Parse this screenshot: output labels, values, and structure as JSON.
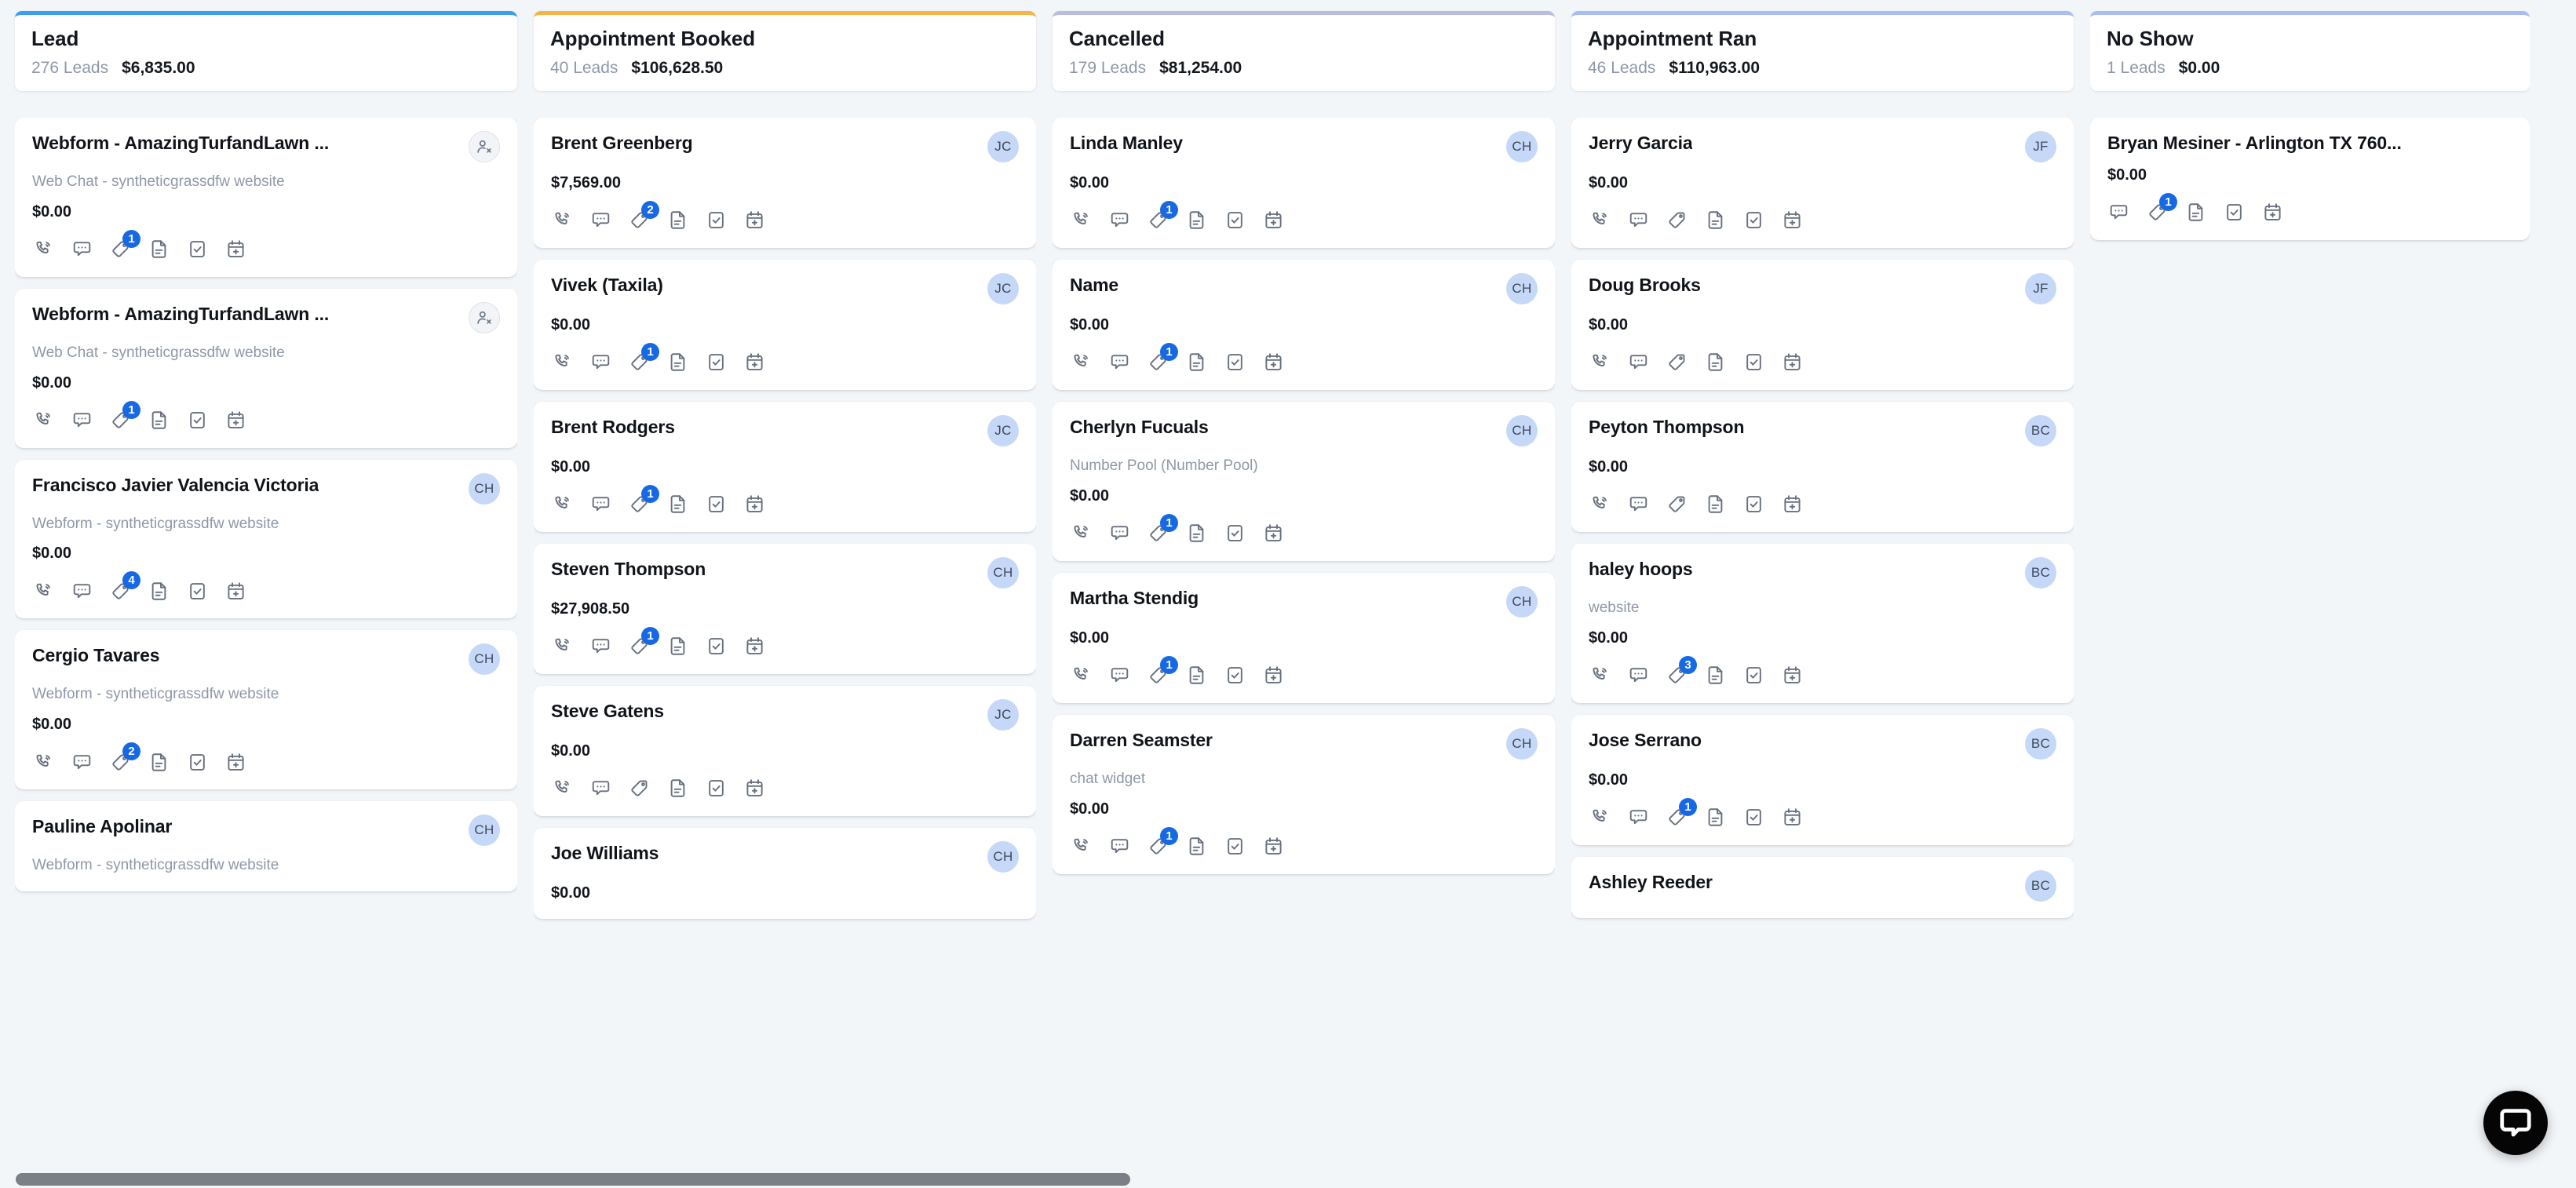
{
  "board": {
    "scrollbar": {
      "name": "horizontal-scrollbar"
    },
    "chat_widget": {
      "label": "chat-widget",
      "icon": "chat-bubble-icon"
    }
  },
  "icon_names": {
    "phone": "phone-call-icon",
    "chat": "chat-bubble-icon",
    "tag": "tag-icon",
    "doc": "document-icon",
    "task": "task-checkbox-icon",
    "calendar": "calendar-add-icon",
    "unassigned": "user-remove-icon"
  },
  "colors": {
    "accent_blue": "#3b9cf0",
    "accent_orange": "#f7b548",
    "accent_lavender": "#b9bce0",
    "accent_periwinkle": "#a9bdf2",
    "badge_blue": "#1668e3",
    "avatar_bg": "#c5d8f7",
    "board_bg": "#f3f6f9"
  },
  "columns": [
    {
      "title": "Lead",
      "leads": "276 Leads",
      "amount": "$6,835.00",
      "top_color": "#3b9cf0",
      "cards": [
        {
          "name": "Webform - AmazingTurfandLawn ...",
          "subtitle": "Web Chat - syntheticgrassdfw website",
          "amount": "$0.00",
          "avatar": "",
          "avatar_icon": "user-remove-icon",
          "icons": [
            "phone",
            "chat",
            "tag",
            "doc",
            "task",
            "calendar"
          ],
          "badge": "1"
        },
        {
          "name": "Webform - AmazingTurfandLawn ...",
          "subtitle": "Web Chat - syntheticgrassdfw website",
          "amount": "$0.00",
          "avatar": "",
          "avatar_icon": "user-remove-icon",
          "icons": [
            "phone",
            "chat",
            "tag",
            "doc",
            "task",
            "calendar"
          ],
          "badge": "1"
        },
        {
          "name": "Francisco Javier Valencia Victoria",
          "subtitle": "Webform - syntheticgrassdfw website",
          "amount": "$0.00",
          "avatar": "CH",
          "icons": [
            "phone",
            "chat",
            "tag",
            "doc",
            "task",
            "calendar"
          ],
          "badge": "4"
        },
        {
          "name": "Cergio Tavares",
          "subtitle": "Webform - syntheticgrassdfw website",
          "amount": "$0.00",
          "avatar": "CH",
          "icons": [
            "phone",
            "chat",
            "tag",
            "doc",
            "task",
            "calendar"
          ],
          "badge": "2"
        },
        {
          "name": "Pauline Apolinar",
          "subtitle": "Webform - syntheticgrassdfw website",
          "amount": "",
          "avatar": "CH",
          "icons": [],
          "badge": ""
        }
      ]
    },
    {
      "title": "Appointment Booked",
      "leads": "40 Leads",
      "amount": "$106,628.50",
      "top_color": "#f7b548",
      "cards": [
        {
          "name": "Brent Greenberg",
          "subtitle": "",
          "amount": "$7,569.00",
          "avatar": "JC",
          "icons": [
            "phone",
            "chat",
            "tag",
            "doc",
            "task",
            "calendar"
          ],
          "badge": "2"
        },
        {
          "name": "Vivek (Taxila)",
          "subtitle": "",
          "amount": "$0.00",
          "avatar": "JC",
          "icons": [
            "phone",
            "chat",
            "tag",
            "doc",
            "task",
            "calendar"
          ],
          "badge": "1"
        },
        {
          "name": "Brent Rodgers",
          "subtitle": "",
          "amount": "$0.00",
          "avatar": "JC",
          "icons": [
            "phone",
            "chat",
            "tag",
            "doc",
            "task",
            "calendar"
          ],
          "badge": "1"
        },
        {
          "name": "Steven Thompson",
          "subtitle": "",
          "amount": "$27,908.50",
          "avatar": "CH",
          "icons": [
            "phone",
            "chat",
            "tag",
            "doc",
            "task",
            "calendar"
          ],
          "badge": "1"
        },
        {
          "name": "Steve Gatens",
          "subtitle": "",
          "amount": "$0.00",
          "avatar": "JC",
          "icons": [
            "phone",
            "chat",
            "tag",
            "doc",
            "task",
            "calendar"
          ],
          "badge": ""
        },
        {
          "name": "Joe Williams",
          "subtitle": "",
          "amount": "$0.00",
          "avatar": "CH",
          "icons": [],
          "badge": ""
        }
      ]
    },
    {
      "title": "Cancelled",
      "leads": "179 Leads",
      "amount": "$81,254.00",
      "top_color": "#b9bce0",
      "cards": [
        {
          "name": "Linda Manley",
          "subtitle": "",
          "amount": "$0.00",
          "avatar": "CH",
          "icons": [
            "phone",
            "chat",
            "tag",
            "doc",
            "task",
            "calendar"
          ],
          "badge": "1"
        },
        {
          "name": "Name",
          "subtitle": "",
          "amount": "$0.00",
          "avatar": "CH",
          "icons": [
            "phone",
            "chat",
            "tag",
            "doc",
            "task",
            "calendar"
          ],
          "badge": "1"
        },
        {
          "name": "Cherlyn Fucuals",
          "subtitle": "Number Pool (Number Pool)",
          "amount": "$0.00",
          "avatar": "CH",
          "icons": [
            "phone",
            "chat",
            "tag",
            "doc",
            "task",
            "calendar"
          ],
          "badge": "1"
        },
        {
          "name": "Martha Stendig",
          "subtitle": "",
          "amount": "$0.00",
          "avatar": "CH",
          "icons": [
            "phone",
            "chat",
            "tag",
            "doc",
            "task",
            "calendar"
          ],
          "badge": "1"
        },
        {
          "name": "Darren Seamster",
          "subtitle": "chat widget",
          "amount": "$0.00",
          "avatar": "CH",
          "icons": [
            "phone",
            "chat",
            "tag",
            "doc",
            "task",
            "calendar"
          ],
          "badge": "1"
        }
      ]
    },
    {
      "title": "Appointment Ran",
      "leads": "46 Leads",
      "amount": "$110,963.00",
      "top_color": "#a9bdf2",
      "cards": [
        {
          "name": "Jerry Garcia",
          "subtitle": "",
          "amount": "$0.00",
          "avatar": "JF",
          "icons": [
            "phone",
            "chat",
            "tag",
            "doc",
            "task",
            "calendar"
          ],
          "badge": ""
        },
        {
          "name": "Doug Brooks",
          "subtitle": "",
          "amount": "$0.00",
          "avatar": "JF",
          "icons": [
            "phone",
            "chat",
            "tag",
            "doc",
            "task",
            "calendar"
          ],
          "badge": ""
        },
        {
          "name": "Peyton Thompson",
          "subtitle": "",
          "amount": "$0.00",
          "avatar": "BC",
          "icons": [
            "phone",
            "chat",
            "tag",
            "doc",
            "task",
            "calendar"
          ],
          "badge": ""
        },
        {
          "name": "haley hoops",
          "subtitle": "website",
          "amount": "$0.00",
          "avatar": "BC",
          "icons": [
            "phone",
            "chat",
            "tag",
            "doc",
            "task",
            "calendar"
          ],
          "badge": "3"
        },
        {
          "name": "Jose Serrano",
          "subtitle": "",
          "amount": "$0.00",
          "avatar": "BC",
          "icons": [
            "phone",
            "chat",
            "tag",
            "doc",
            "task",
            "calendar"
          ],
          "badge": "1"
        },
        {
          "name": "Ashley Reeder",
          "subtitle": "",
          "amount": "",
          "avatar": "BC",
          "icons": [],
          "badge": ""
        }
      ]
    },
    {
      "title": "No Show",
      "leads": "1 Leads",
      "amount": "$0.00",
      "top_color": "#a9bdf2",
      "cards": [
        {
          "name": "Bryan Mesiner - Arlington TX 760...",
          "subtitle": "",
          "amount": "$0.00",
          "avatar": "",
          "icons": [
            "chat",
            "tag",
            "doc",
            "task",
            "calendar"
          ],
          "badge": "1"
        }
      ]
    }
  ]
}
